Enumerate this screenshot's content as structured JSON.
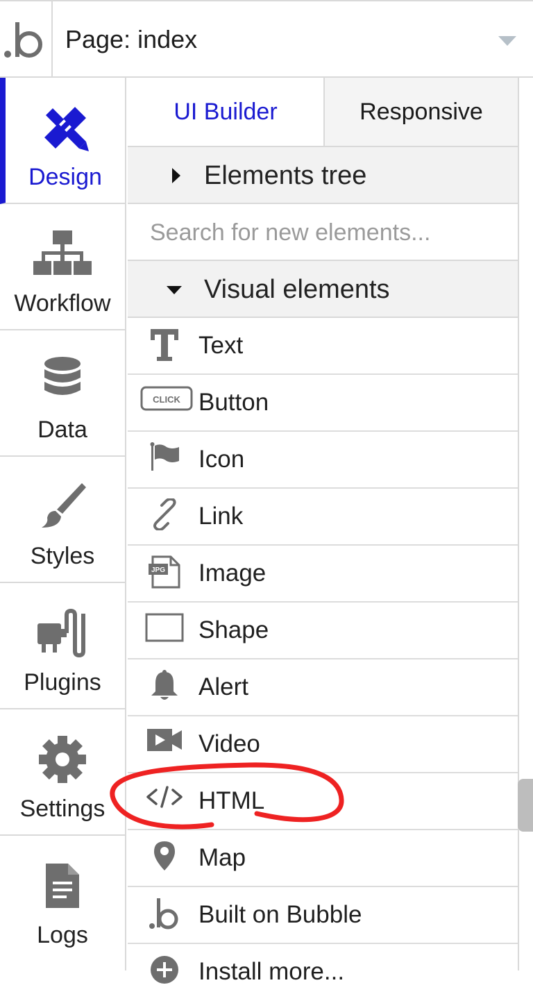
{
  "topbar": {
    "logo_icon": "bubble-logo-icon",
    "page_selector_label": "Page: index",
    "chevron_icon": "chevron-down-icon"
  },
  "nav": {
    "items": [
      {
        "label": "Design",
        "icon": "design-tools-icon",
        "active": true
      },
      {
        "label": "Workflow",
        "icon": "workflow-icon"
      },
      {
        "label": "Data",
        "icon": "database-icon"
      },
      {
        "label": "Styles",
        "icon": "paintbrush-icon"
      },
      {
        "label": "Plugins",
        "icon": "plug-icon"
      },
      {
        "label": "Settings",
        "icon": "gear-icon"
      },
      {
        "label": "Logs",
        "icon": "document-icon"
      }
    ]
  },
  "tabs": {
    "ui_builder": "UI Builder",
    "responsive": "Responsive"
  },
  "elements_tree": {
    "title": "Elements tree"
  },
  "search": {
    "placeholder": "Search for new elements..."
  },
  "visual_elements": {
    "title": "Visual elements",
    "items": [
      {
        "label": "Text",
        "icon": "text-icon"
      },
      {
        "label": "Button",
        "icon": "button-icon",
        "icon_text": "CLICK"
      },
      {
        "label": "Icon",
        "icon": "flag-icon"
      },
      {
        "label": "Link",
        "icon": "link-icon"
      },
      {
        "label": "Image",
        "icon": "image-icon",
        "icon_text": "JPG"
      },
      {
        "label": "Shape",
        "icon": "shape-icon"
      },
      {
        "label": "Alert",
        "icon": "bell-icon"
      },
      {
        "label": "Video",
        "icon": "video-icon"
      },
      {
        "label": "HTML",
        "icon": "code-icon"
      },
      {
        "label": "Map",
        "icon": "map-pin-icon"
      },
      {
        "label": "Built on Bubble",
        "icon": "bubble-logo-icon"
      },
      {
        "label": "Install more...",
        "icon": "plus-circle-icon"
      }
    ]
  },
  "colors": {
    "accent": "#1a1ad1",
    "annotation": "#ee2222",
    "icon_gray": "#6e6e6e",
    "border": "#d9d9d9"
  }
}
